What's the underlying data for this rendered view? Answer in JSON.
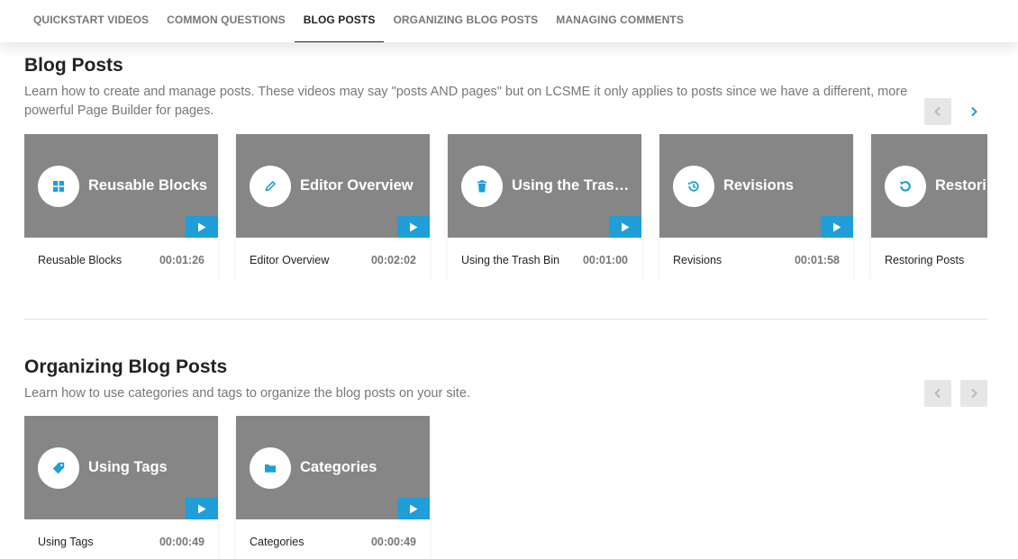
{
  "nav": {
    "tabs": [
      {
        "label": "QUICKSTART VIDEOS",
        "active": false
      },
      {
        "label": "COMMON QUESTIONS",
        "active": false
      },
      {
        "label": "BLOG POSTS",
        "active": true
      },
      {
        "label": "ORGANIZING BLOG POSTS",
        "active": false
      },
      {
        "label": "MANAGING COMMENTS",
        "active": false
      }
    ]
  },
  "colors": {
    "accent": "#1f9ed8",
    "thumbnail_bg": "#868686",
    "disabled_arrow_bg": "#e6e6e6"
  },
  "sections": [
    {
      "title": "Blog Posts",
      "description": "Learn how to create and manage posts. These videos may say \"posts AND pages\" but on LCSME it only applies to posts since we have a different, more powerful Page Builder for pages.",
      "prev_enabled": false,
      "next_enabled": true,
      "cards": [
        {
          "title": "Reusable Blocks",
          "thumb_title": "Reusable Blocks",
          "duration": "00:01:26",
          "icon": "grid-icon"
        },
        {
          "title": "Editor Overview",
          "thumb_title": "Editor Overview",
          "duration": "00:02:02",
          "icon": "pencil-icon"
        },
        {
          "title": "Using the Trash Bin",
          "thumb_title": "Using the Trash ...",
          "duration": "00:01:00",
          "icon": "trash-icon"
        },
        {
          "title": "Revisions",
          "thumb_title": "Revisions",
          "duration": "00:01:58",
          "icon": "history-icon"
        },
        {
          "title": "Restoring Posts",
          "thumb_title": "Restoring Posts",
          "duration": "",
          "icon": "restore-icon"
        }
      ]
    },
    {
      "title": "Organizing Blog Posts",
      "description": "Learn how to use categories and tags to organize the blog posts on your site.",
      "prev_enabled": false,
      "next_enabled": false,
      "cards": [
        {
          "title": "Using Tags",
          "thumb_title": "Using Tags",
          "duration": "00:00:49",
          "icon": "tag-icon"
        },
        {
          "title": "Categories",
          "thumb_title": "Categories",
          "duration": "00:00:49",
          "icon": "folder-icon"
        }
      ]
    }
  ]
}
